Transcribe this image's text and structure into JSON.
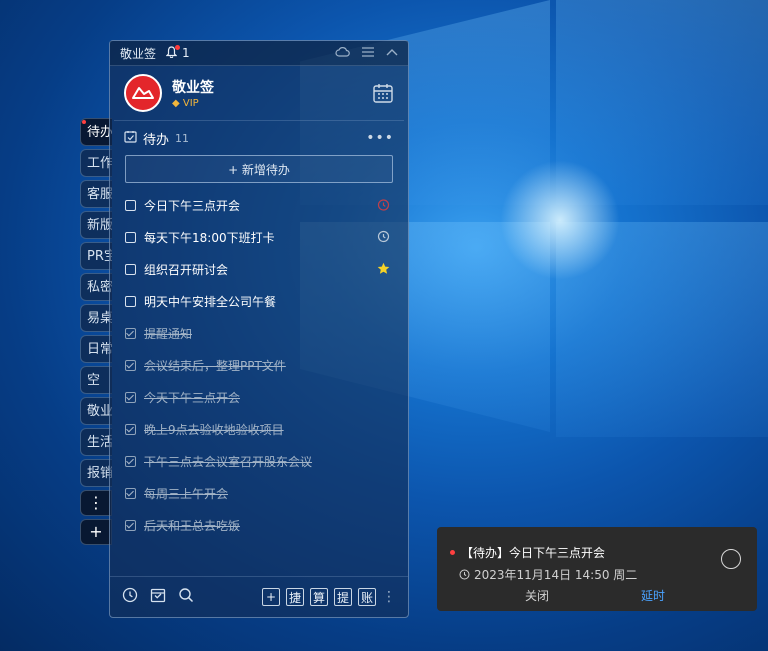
{
  "sidebar": {
    "tabs": [
      "待办",
      "工作",
      "客服",
      "新版",
      "PR宝",
      "私密",
      "易桌",
      "日常",
      "空",
      "敬业",
      "生活",
      "报销"
    ],
    "more_label": "⋮",
    "add_label": "+"
  },
  "panel": {
    "title": "敬业签",
    "bell_count": "1",
    "profile_name": "敬业签",
    "vip_label": "VIP",
    "list_title": "待办",
    "list_count": "11",
    "more_label": "•••",
    "add_button": "+ 新增待办",
    "items": [
      {
        "text": "今日下午三点开会",
        "done": false,
        "icon": "alarm-icon"
      },
      {
        "text": "每天下午18:00下班打卡",
        "done": false,
        "icon": "clock-icon"
      },
      {
        "text": "组织召开研讨会",
        "done": false,
        "icon": "star-icon"
      },
      {
        "text": "明天中午安排全公司午餐",
        "done": false,
        "icon": ""
      },
      {
        "text": "提醒通知",
        "done": true,
        "icon": ""
      },
      {
        "text": "会议结束后，整理PPT文件",
        "done": true,
        "icon": ""
      },
      {
        "text": "今天下午三点开会",
        "done": true,
        "icon": ""
      },
      {
        "text": "晚上9点去验收地验收项目",
        "done": true,
        "icon": ""
      },
      {
        "text": "下午三点去会议室召开股东会议",
        "done": true,
        "icon": ""
      },
      {
        "text": "每周三上午开会",
        "done": true,
        "icon": ""
      },
      {
        "text": "后天和王总去吃饭",
        "done": true,
        "icon": ""
      }
    ],
    "footer_buttons": [
      "+",
      "捷",
      "算",
      "提",
      "账"
    ]
  },
  "notification": {
    "title": "【待办】今日下午三点开会",
    "time": "2023年11月14日 14:50 周二",
    "close_label": "关闭",
    "delay_label": "延时"
  },
  "colors": {
    "accent_red": "#e3262b",
    "vip_gold": "#f2b63c",
    "star_yellow": "#f5d327",
    "link_blue": "#4aa3ff"
  }
}
